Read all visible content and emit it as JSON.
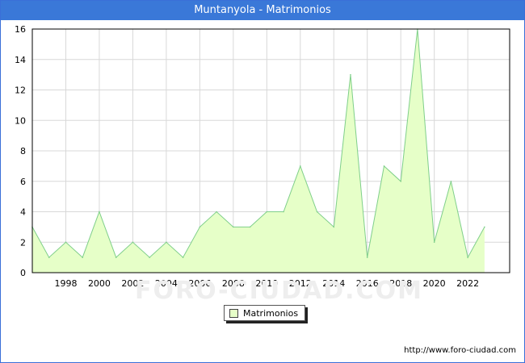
{
  "window": {
    "title": "Muntanyola - Matrimonios"
  },
  "chart_data": {
    "type": "area",
    "title": "Muntanyola - Matrimonios",
    "xlabel": "",
    "ylabel": "",
    "x": [
      1996,
      1997,
      1998,
      1999,
      2000,
      2001,
      2002,
      2003,
      2004,
      2005,
      2006,
      2007,
      2008,
      2009,
      2010,
      2011,
      2012,
      2013,
      2014,
      2015,
      2016,
      2017,
      2018,
      2019,
      2020,
      2021,
      2022,
      2023
    ],
    "series": [
      {
        "name": "Matrimonios",
        "values": [
          3,
          1,
          2,
          1,
          4,
          1,
          2,
          1,
          2,
          1,
          3,
          4,
          3,
          3,
          4,
          4,
          7,
          4,
          3,
          13,
          1,
          7,
          6,
          16,
          2,
          6,
          1,
          3
        ]
      }
    ],
    "xlim": [
      1996,
      2024.5
    ],
    "ylim": [
      0,
      16
    ],
    "yticks": [
      0,
      2,
      4,
      6,
      8,
      10,
      12,
      14,
      16
    ],
    "xticks": [
      1998,
      2000,
      2002,
      2004,
      2006,
      2008,
      2010,
      2012,
      2014,
      2016,
      2018,
      2020,
      2022
    ],
    "grid": true,
    "legend_position": "bottom-center",
    "colors": {
      "fill": "#e6ffc8",
      "line": "#7fcf8a",
      "grid": "#d8d8d8",
      "title_bg": "#3a78d8"
    },
    "watermark": "FORO-CIUDAD.COM"
  },
  "footer": {
    "url": "http://www.foro-ciudad.com"
  }
}
